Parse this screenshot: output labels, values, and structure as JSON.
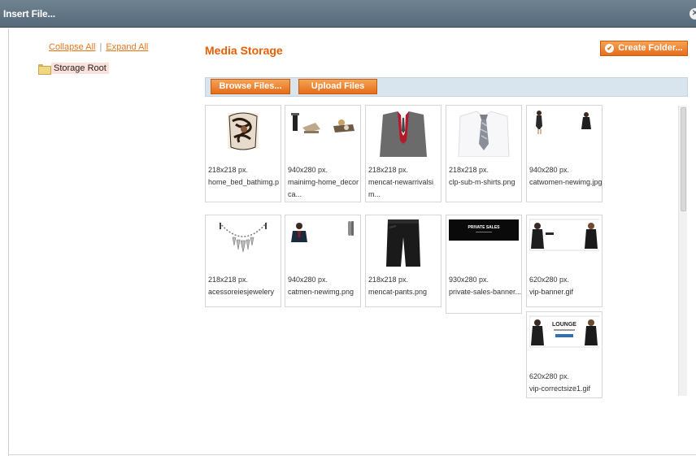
{
  "window": {
    "title": "Insert File...",
    "close_glyph": "✕"
  },
  "tree": {
    "collapse_all": "Collapse All",
    "separator": "|",
    "expand_all": "Expand All",
    "root_label": "Storage Root"
  },
  "main": {
    "heading": "Media Storage",
    "create_folder": "Create Folder...",
    "browse_files": "Browse Files...",
    "upload_files": "Upload Files"
  },
  "files": [
    {
      "size": "218x218 px.",
      "name": "home_bed_bathimg.p",
      "icon": "pillow-thumbnail"
    },
    {
      "size": "940x280 px.",
      "name": "mainimg-home_decorca...",
      "icon": "home-decor-thumbnail"
    },
    {
      "size": "218x218 px.",
      "name": "mencat-newarrivalsim...",
      "icon": "suit-thumbnail"
    },
    {
      "size": "218x218 px.",
      "name": "clp-sub-m-shirts.png",
      "icon": "shirt-tie-thumbnail"
    },
    {
      "size": "940x280 px.",
      "name": "catwomen-newimg.jpg",
      "icon": "women-thumbnail"
    },
    {
      "size": "218x218 px.",
      "name": "acessoreiesjewelery",
      "icon": "necklace-thumbnail"
    },
    {
      "size": "940x280 px.",
      "name": "catmen-newimg.png",
      "icon": "men-thumbnail"
    },
    {
      "size": "218x218 px.",
      "name": "mencat-pants.png",
      "icon": "pants-thumbnail"
    },
    {
      "size": "930x280 px.",
      "name": "private-sales-banner...",
      "icon": "private-sales-thumbnail",
      "banner_text": "PRIVATE SALES"
    },
    {
      "size": "620x280 px.",
      "name": "vip-banner.gif",
      "icon": "vip-banner-thumbnail"
    },
    {
      "size": "620x280 px.",
      "name": "vip-correctsize1.gif",
      "icon": "vip-lounge-thumbnail",
      "banner_text": "LOUNGE"
    }
  ],
  "colors": {
    "accent": "#eb5e00",
    "button": "#e66d1a",
    "titlebar": "#5f7282",
    "band": "#d9e5ee"
  }
}
